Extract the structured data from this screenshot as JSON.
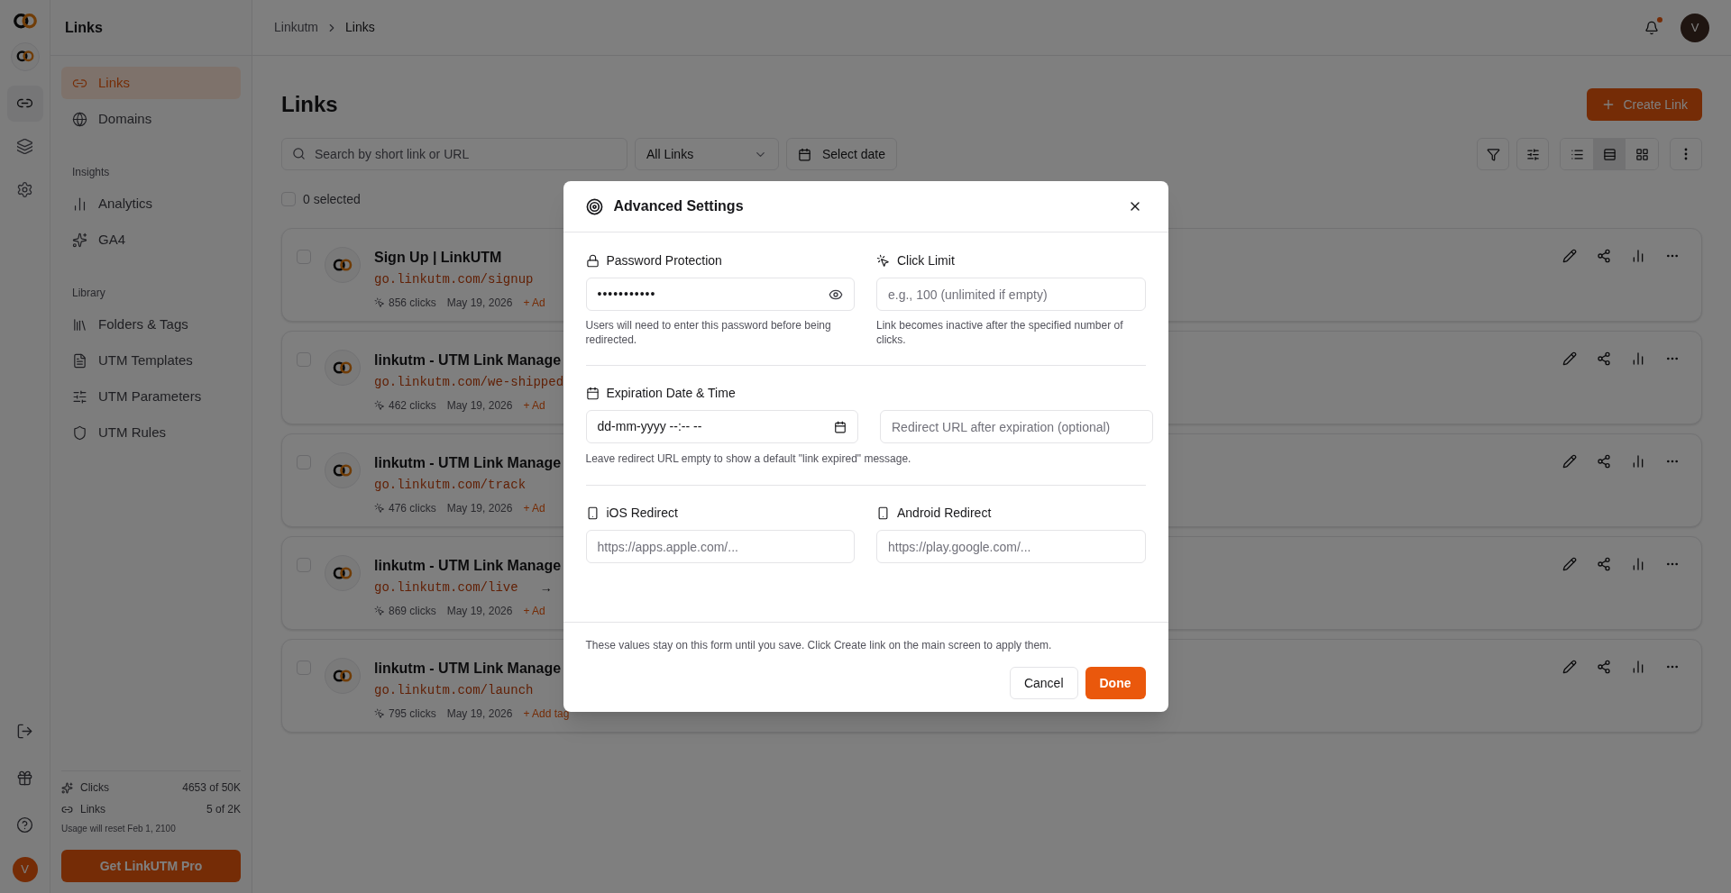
{
  "rail": {
    "items": [
      {
        "kind": "links",
        "selected": true
      },
      {
        "kind": "layers",
        "selected": false
      },
      {
        "kind": "settings",
        "selected": false
      }
    ],
    "bottom": [
      {
        "kind": "logout"
      },
      {
        "kind": "gift"
      },
      {
        "kind": "help"
      }
    ],
    "avatar": "V"
  },
  "sidebar": {
    "title": "Links",
    "items": [
      {
        "label": "Links",
        "kind": "link",
        "selected": true
      },
      {
        "label": "Domains",
        "kind": "globe",
        "selected": false
      }
    ],
    "sections": [
      {
        "heading": "Insights",
        "items": [
          {
            "label": "Analytics",
            "kind": "chart",
            "selected": false
          },
          {
            "label": "GA4",
            "kind": "sparkles",
            "selected": false
          }
        ]
      },
      {
        "heading": "Library",
        "items": [
          {
            "label": "Folders & Tags",
            "kind": "library",
            "selected": false
          },
          {
            "label": "UTM Templates",
            "kind": "file",
            "selected": false
          },
          {
            "label": "UTM Parameters",
            "kind": "sliders",
            "selected": false
          },
          {
            "label": "UTM Rules",
            "kind": "shield",
            "selected": false
          }
        ]
      }
    ],
    "usage": [
      {
        "label": "Clicks",
        "value": "4653 of 50K",
        "kind": "clicks"
      },
      {
        "label": "Links",
        "value": "5 of 2K",
        "kind": "links"
      }
    ],
    "reset_note": "Usage will reset Feb 1, 2100",
    "upgrade_button": "Get LinkUTM Pro"
  },
  "header": {
    "breadcrumb": [
      "Linkutm",
      "Links"
    ],
    "notification": true,
    "avatar": "V"
  },
  "page": {
    "title": "Links",
    "create_button": "Create Link",
    "search": {
      "placeholder": "Search by short link or URL"
    },
    "filter": "All Links",
    "date_button": "Select date",
    "view_modes": [
      {
        "kind": "list",
        "selected": false
      },
      {
        "kind": "rows",
        "selected": true
      },
      {
        "kind": "grid",
        "selected": false
      }
    ],
    "select_all": {
      "label": "0 selected",
      "checked": false
    }
  },
  "links": [
    {
      "title": "Sign Up | LinkUTM",
      "url": "go.linkutm.com/signup",
      "clicks": "856 clicks",
      "date": "May 19, 2026",
      "add_tag": "+ Ad",
      "checked": false
    },
    {
      "title": "linkutm - UTM Link Manage",
      "url": "go.linkutm.com/we-shipped",
      "clicks": "462 clicks",
      "date": "May 19, 2026",
      "add_tag": "+ Ad",
      "checked": false
    },
    {
      "title": "linkutm - UTM Link Manage",
      "url": "go.linkutm.com/track",
      "clicks": "476 clicks",
      "date": "May 19, 2026",
      "add_tag": "+ Ad",
      "checked": false
    },
    {
      "title": "linkutm - UTM Link Manage",
      "url": "go.linkutm.com/live",
      "arrow": "→",
      "clicks": "869 clicks",
      "date": "May 19, 2026",
      "add_tag": "+ Ad",
      "checked": false
    },
    {
      "title": "linkutm - UTM Link Manage",
      "url": "go.linkutm.com/launch",
      "clicks": "795 clicks",
      "date": "May 19, 2026",
      "add_tag": "+ Add tag",
      "checked": false
    }
  ],
  "modal": {
    "title": "Advanced Settings",
    "password": {
      "label": "Password Protection",
      "value": "•••••••••••",
      "help": "Users will need to enter this password before being redirected."
    },
    "click_limit": {
      "label": "Click Limit",
      "placeholder": "e.g., 100 (unlimited if empty)",
      "help": "Link becomes inactive after the specified number of clicks."
    },
    "expiration": {
      "label": "Expiration Date & Time",
      "value": "dd-mm-yyyy --:-- --",
      "redirect_placeholder": "Redirect URL after expiration (optional)",
      "help": "Leave redirect URL empty to show a default \"link expired\" message."
    },
    "ios": {
      "label": "iOS Redirect",
      "placeholder": "https://apps.apple.com/..."
    },
    "android": {
      "label": "Android Redirect",
      "placeholder": "https://play.google.com/..."
    },
    "footer_note": "These values stay on this form until you save. Click Create link on the main screen to apply them.",
    "cancel_button": "Cancel",
    "done_button": "Done"
  }
}
